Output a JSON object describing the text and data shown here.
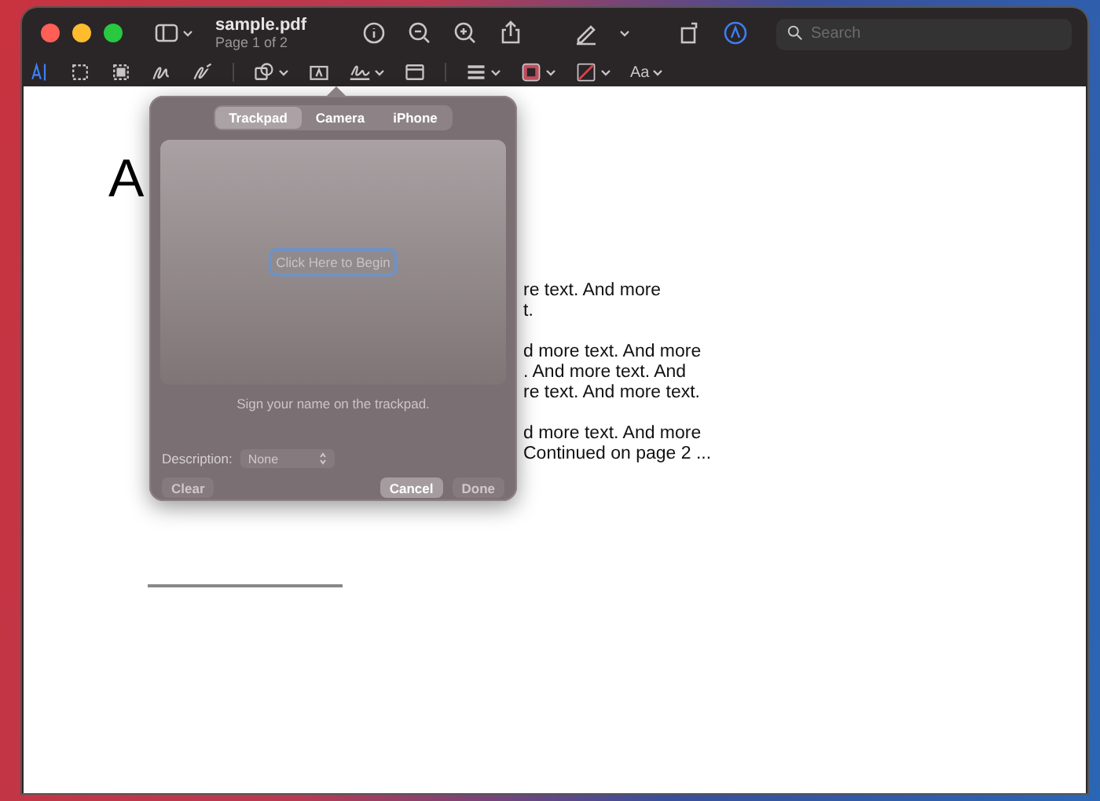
{
  "window": {
    "title": "sample.pdf",
    "subtitle": "Page 1 of 2"
  },
  "search": {
    "placeholder": "Search"
  },
  "toolbar": {
    "font_button": "Aa"
  },
  "document": {
    "heading": "A",
    "paragraphs": [
      [
        "re text. And more",
        "t."
      ],
      [
        "d more text. And more",
        ". And more text. And",
        "re text. And more text."
      ],
      [
        "d more text. And more",
        "Continued on page 2 ..."
      ]
    ]
  },
  "popover": {
    "tabs": [
      {
        "label": "Trackpad",
        "selected": true
      },
      {
        "label": "Camera",
        "selected": false
      },
      {
        "label": "iPhone",
        "selected": false
      }
    ],
    "begin_button": "Click Here to Begin",
    "hint": "Sign your name on the trackpad.",
    "description_label": "Description:",
    "description_value": "None",
    "buttons": [
      {
        "label": "Clear",
        "disabled": true
      },
      {
        "label": "Cancel",
        "disabled": false
      },
      {
        "label": "Done",
        "disabled": true
      }
    ]
  }
}
